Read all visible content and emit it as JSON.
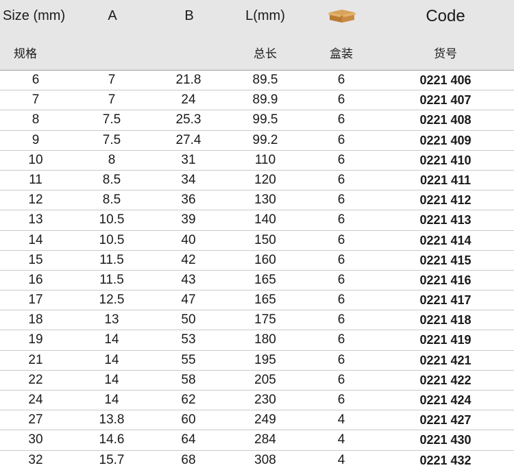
{
  "header": {
    "row1": [
      "Size (mm)",
      "A",
      "B",
      "L(mm)",
      "",
      "Code"
    ],
    "row2": [
      "规格",
      "",
      "",
      "总长",
      "盒装",
      "货号"
    ],
    "box_icon": "cardboard-box-icon"
  },
  "rows": [
    [
      "6",
      "7",
      "21.8",
      "89.5",
      "6",
      "0221 406"
    ],
    [
      "7",
      "7",
      "24",
      "89.9",
      "6",
      "0221 407"
    ],
    [
      "8",
      "7.5",
      "25.3",
      "99.5",
      "6",
      "0221 408"
    ],
    [
      "9",
      "7.5",
      "27.4",
      "99.2",
      "6",
      "0221 409"
    ],
    [
      "10",
      "8",
      "31",
      "110",
      "6",
      "0221 410"
    ],
    [
      "11",
      "8.5",
      "34",
      "120",
      "6",
      "0221 411"
    ],
    [
      "12",
      "8.5",
      "36",
      "130",
      "6",
      "0221 412"
    ],
    [
      "13",
      "10.5",
      "39",
      "140",
      "6",
      "0221 413"
    ],
    [
      "14",
      "10.5",
      "40",
      "150",
      "6",
      "0221 414"
    ],
    [
      "15",
      "11.5",
      "42",
      "160",
      "6",
      "0221 415"
    ],
    [
      "16",
      "11.5",
      "43",
      "165",
      "6",
      "0221 416"
    ],
    [
      "17",
      "12.5",
      "47",
      "165",
      "6",
      "0221 417"
    ],
    [
      "18",
      "13",
      "50",
      "175",
      "6",
      "0221 418"
    ],
    [
      "19",
      "14",
      "53",
      "180",
      "6",
      "0221 419"
    ],
    [
      "21",
      "14",
      "55",
      "195",
      "6",
      "0221 421"
    ],
    [
      "22",
      "14",
      "58",
      "205",
      "6",
      "0221 422"
    ],
    [
      "24",
      "14",
      "62",
      "230",
      "6",
      "0221 424"
    ],
    [
      "27",
      "13.8",
      "60",
      "249",
      "4",
      "0221 427"
    ],
    [
      "30",
      "14.6",
      "64",
      "284",
      "4",
      "0221 430"
    ],
    [
      "32",
      "15.7",
      "68",
      "308",
      "4",
      "0221 432"
    ]
  ]
}
